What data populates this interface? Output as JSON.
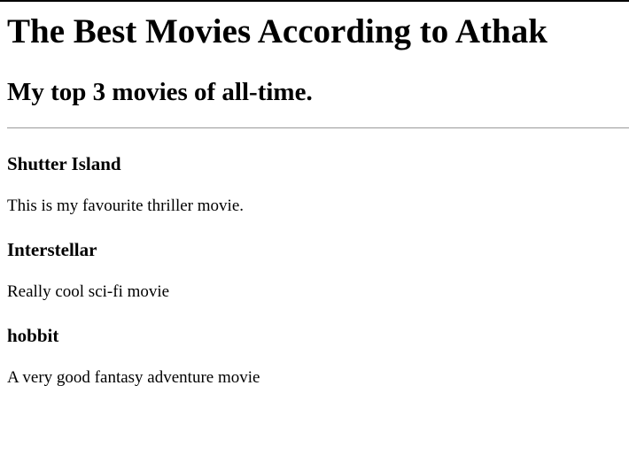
{
  "page": {
    "title": "The Best Movies According to Athak",
    "subtitle": "My top 3 movies of all-time."
  },
  "movies": [
    {
      "name": "Shutter Island",
      "description": "This is my favourite thriller movie."
    },
    {
      "name": "Interstellar",
      "description": "Really cool sci-fi movie"
    },
    {
      "name": "hobbit",
      "description": "A very good fantasy adventure movie"
    }
  ]
}
